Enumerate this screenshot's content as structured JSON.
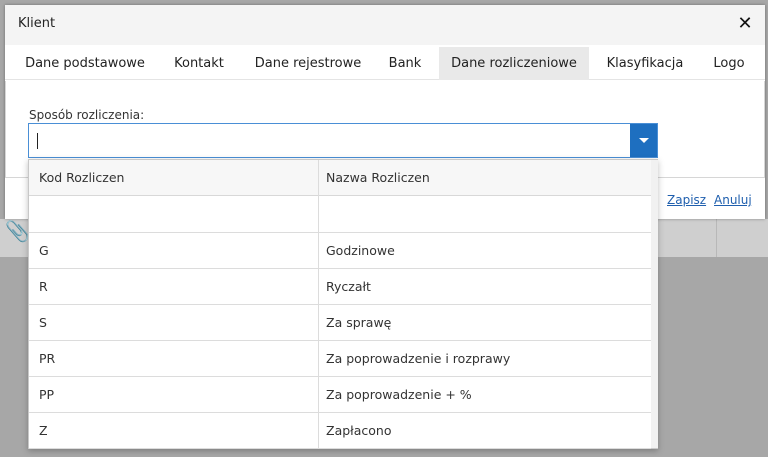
{
  "dialog": {
    "title": "Klient",
    "close_label": "✕",
    "tabs": [
      {
        "label": "Dane podstawowe"
      },
      {
        "label": "Kontakt"
      },
      {
        "label": "Dane rejestrowe"
      },
      {
        "label": "Bank"
      },
      {
        "label": "Dane rozliczeniowe"
      },
      {
        "label": "Klasyfikacja"
      },
      {
        "label": "Logo"
      }
    ],
    "active_tab": "Dane rozliczeniowe",
    "field": {
      "label": "Sposób rozliczenia:",
      "value": ""
    },
    "actions": {
      "save_label": "Zapisz",
      "cancel_label": "Anuluj"
    }
  },
  "dropdown": {
    "columns": [
      "Kod Rozliczen",
      "Nazwa Rozliczen"
    ],
    "rows": [
      {
        "code": "",
        "name": ""
      },
      {
        "code": "G",
        "name": "Godzinowe"
      },
      {
        "code": "R",
        "name": "Ryczałt"
      },
      {
        "code": "S",
        "name": "Za sprawę"
      },
      {
        "code": "PR",
        "name": "Za poprowadzenie i rozprawy"
      },
      {
        "code": "PP",
        "name": "Za poprowadzenie + %"
      },
      {
        "code": "Z",
        "name": "Zapłacono"
      }
    ]
  },
  "colors": {
    "accent": "#1e6fc0",
    "link": "#1f5fae",
    "active_tab": "#e9e9e9"
  }
}
